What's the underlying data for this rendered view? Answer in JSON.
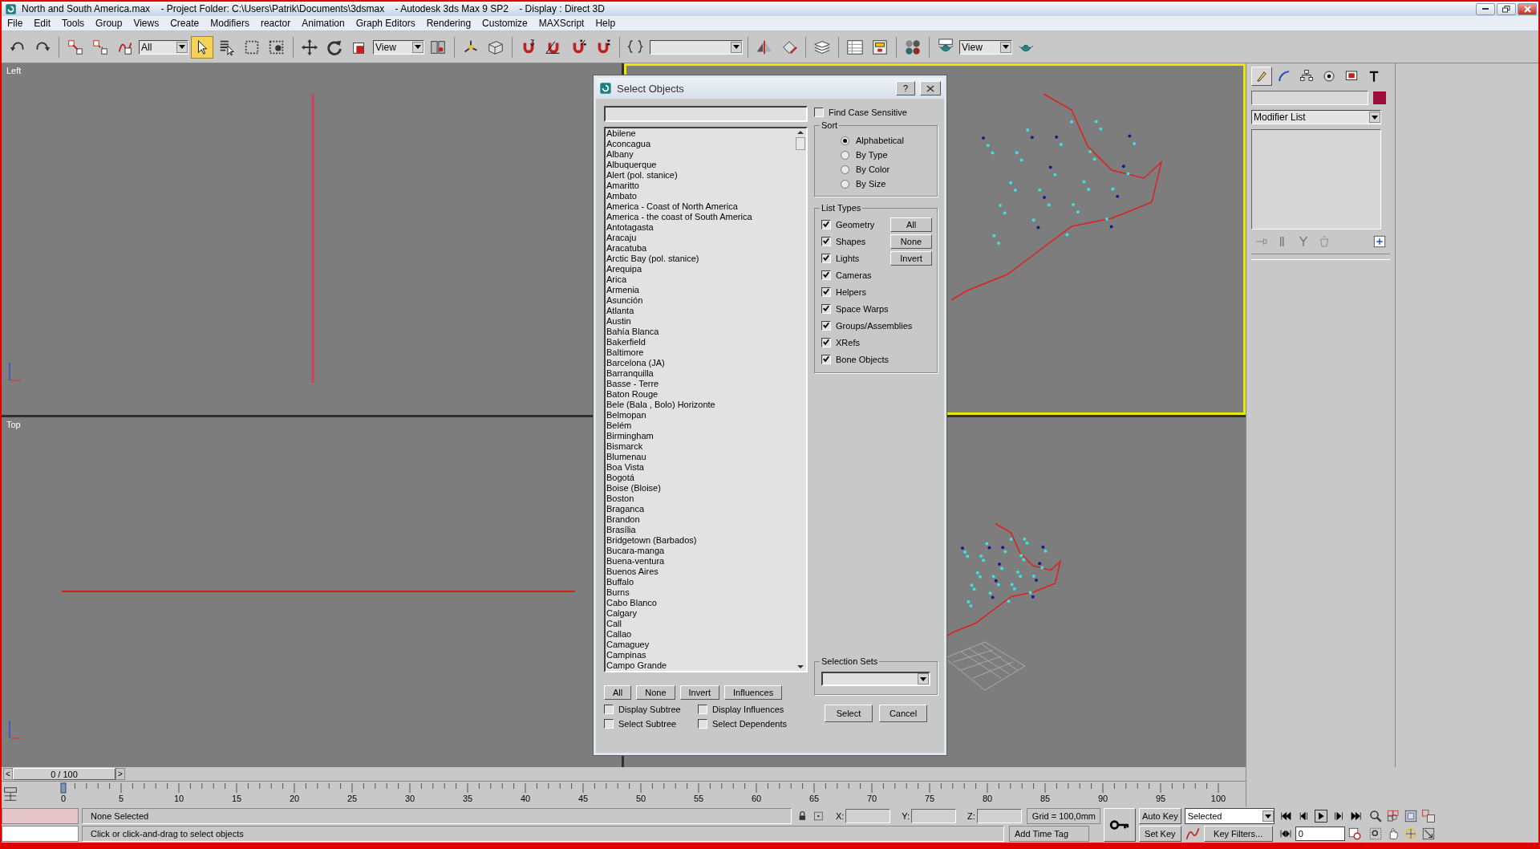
{
  "window": {
    "title": "North and South America.max    - Project Folder: C:\\Users\\Patrik\\Documents\\3dsmax    - Autodesk 3ds Max 9 SP2    - Display : Direct 3D"
  },
  "menu": [
    "File",
    "Edit",
    "Tools",
    "Group",
    "Views",
    "Create",
    "Modifiers",
    "reactor",
    "Animation",
    "Graph Editors",
    "Rendering",
    "Customize",
    "MAXScript",
    "Help"
  ],
  "toolbar": {
    "selection_filter": "All",
    "select_tool_active": true,
    "reference_coordinate": "View",
    "render_view": "View"
  },
  "viewports": [
    {
      "kind": "left",
      "label": "Left",
      "active": false
    },
    {
      "kind": "front",
      "active": true
    },
    {
      "kind": "top",
      "label": "Top",
      "active": false
    },
    {
      "kind": "perspective",
      "active": false
    }
  ],
  "dialog": {
    "title": "Select Objects",
    "help": "?",
    "find_case_sensitive": {
      "label": "Find Case Sensitive",
      "checked": false
    },
    "items": [
      {
        "name": "Abilene",
        "selected": false
      },
      {
        "name": "Aconcagua",
        "selected": false
      },
      {
        "name": "Albany",
        "selected": false
      },
      {
        "name": "Albuquerque",
        "selected": false
      },
      {
        "name": "Alert (pol. stanice)",
        "selected": false
      },
      {
        "name": "Amaritto",
        "selected": false
      },
      {
        "name": "Ambato",
        "selected": false
      },
      {
        "name": "America - Coast of North America",
        "selected": false
      },
      {
        "name": "America - the coast of South America",
        "selected": false
      },
      {
        "name": "Antotagasta",
        "selected": false
      },
      {
        "name": "Aracaju",
        "selected": false
      },
      {
        "name": "Aracatuba",
        "selected": false
      },
      {
        "name": "Arctic Bay (pol. stanice)",
        "selected": false
      },
      {
        "name": "Arequipa",
        "selected": false
      },
      {
        "name": "Arica",
        "selected": false
      },
      {
        "name": "Armenia",
        "selected": false
      },
      {
        "name": "Asunción",
        "selected": false
      },
      {
        "name": "Atlanta",
        "selected": false
      },
      {
        "name": "Austin",
        "selected": false
      },
      {
        "name": "Bahía Blanca",
        "selected": false
      },
      {
        "name": "Bakerfield",
        "selected": false
      },
      {
        "name": "Baltimore",
        "selected": false
      },
      {
        "name": "Barcelona (JA)",
        "selected": false
      },
      {
        "name": "Barranquilla",
        "selected": false
      },
      {
        "name": "Basse - Terre",
        "selected": false
      },
      {
        "name": "Baton Rouge",
        "selected": false
      },
      {
        "name": "Bele (Bala , Bolo) Horizonte",
        "selected": false
      },
      {
        "name": "Belmopan",
        "selected": false
      },
      {
        "name": "Belém",
        "selected": false
      },
      {
        "name": "Birmingham",
        "selected": false
      },
      {
        "name": "Bismarck",
        "selected": false
      },
      {
        "name": "Blumenau",
        "selected": false
      },
      {
        "name": "Boa Vista",
        "selected": false
      },
      {
        "name": "Bogotá",
        "selected": false
      },
      {
        "name": "Boise (Bloise)",
        "selected": false
      },
      {
        "name": "Boston",
        "selected": false
      },
      {
        "name": "Braganca",
        "selected": false
      },
      {
        "name": "Brandon",
        "selected": false
      },
      {
        "name": "Brasília",
        "selected": false
      },
      {
        "name": "Bridgetown (Barbados)",
        "selected": false
      },
      {
        "name": "Bucara-manga",
        "selected": false
      },
      {
        "name": "Buena-ventura",
        "selected": false
      },
      {
        "name": "Buenos Aires",
        "selected": false
      },
      {
        "name": "Buffalo",
        "selected": false
      },
      {
        "name": "Burns",
        "selected": false
      },
      {
        "name": "Cabo Blanco",
        "selected": false
      },
      {
        "name": "Calgary",
        "selected": false
      },
      {
        "name": "Call",
        "selected": false
      },
      {
        "name": "Callao",
        "selected": false
      },
      {
        "name": "Camaguey",
        "selected": false
      },
      {
        "name": "Campinas",
        "selected": false
      },
      {
        "name": "Campo Grande",
        "selected": false
      }
    ],
    "list_buttons": [
      "All",
      "None",
      "Invert",
      "Influences"
    ],
    "options": [
      {
        "label": "Display Subtree",
        "checked": false
      },
      {
        "label": "Display Influences",
        "checked": false
      },
      {
        "label": "Select Subtree",
        "checked": false
      },
      {
        "label": "Select Dependents",
        "checked": false
      }
    ],
    "sort": {
      "title": "Sort",
      "options": [
        {
          "label": "Alphabetical",
          "selected": true
        },
        {
          "label": "By Type",
          "selected": false
        },
        {
          "label": "By Color",
          "selected": false
        },
        {
          "label": "By Size",
          "selected": false
        }
      ]
    },
    "list_types": {
      "title": "List Types",
      "types": [
        {
          "label": "Geometry",
          "checked": true
        },
        {
          "label": "Shapes",
          "checked": true
        },
        {
          "label": "Lights",
          "checked": true
        },
        {
          "label": "Cameras",
          "checked": true
        },
        {
          "label": "Helpers",
          "checked": true
        },
        {
          "label": "Space Warps",
          "checked": true
        },
        {
          "label": "Groups/Assemblies",
          "checked": true
        },
        {
          "label": "XRefs",
          "checked": true
        },
        {
          "label": "Bone Objects",
          "checked": true
        }
      ],
      "buttons": [
        "All",
        "None",
        "Invert"
      ]
    },
    "selection_sets": {
      "title": "Selection Sets"
    },
    "buttons": [
      "Select",
      "Cancel"
    ]
  },
  "command_panel": {
    "tabs": [
      {
        "kind": "create",
        "selected": true
      },
      {
        "kind": "modify",
        "selected": false
      },
      {
        "kind": "hierarchy",
        "selected": false
      },
      {
        "kind": "motion",
        "selected": false
      },
      {
        "kind": "display",
        "selected": false
      },
      {
        "kind": "utilities",
        "selected": false
      }
    ],
    "modifier_list": "Modifier List"
  },
  "time_slider": {
    "prev": "<",
    "position": "0 / 100",
    "level": 0,
    "next": ">"
  },
  "track_ticks": [
    "0",
    "5",
    "10",
    "15",
    "20",
    "25",
    "30",
    "35",
    "40",
    "45",
    "50",
    "55",
    "60",
    "65",
    "70",
    "75",
    "80",
    "85",
    "90",
    "95",
    "100"
  ],
  "status": {
    "selection": "None Selected",
    "prompt": "Click or click-and-drag to select objects",
    "x_label": "X:",
    "y_label": "Y:",
    "z_label": "Z:",
    "grid": "Grid = 100,0mm",
    "time_tag": "Add Time Tag"
  },
  "animation": {
    "auto_key": "Auto Key",
    "set_key": "Set Key",
    "key_mode": "Selected",
    "key_filters": "Key Filters...",
    "frame": "0"
  }
}
